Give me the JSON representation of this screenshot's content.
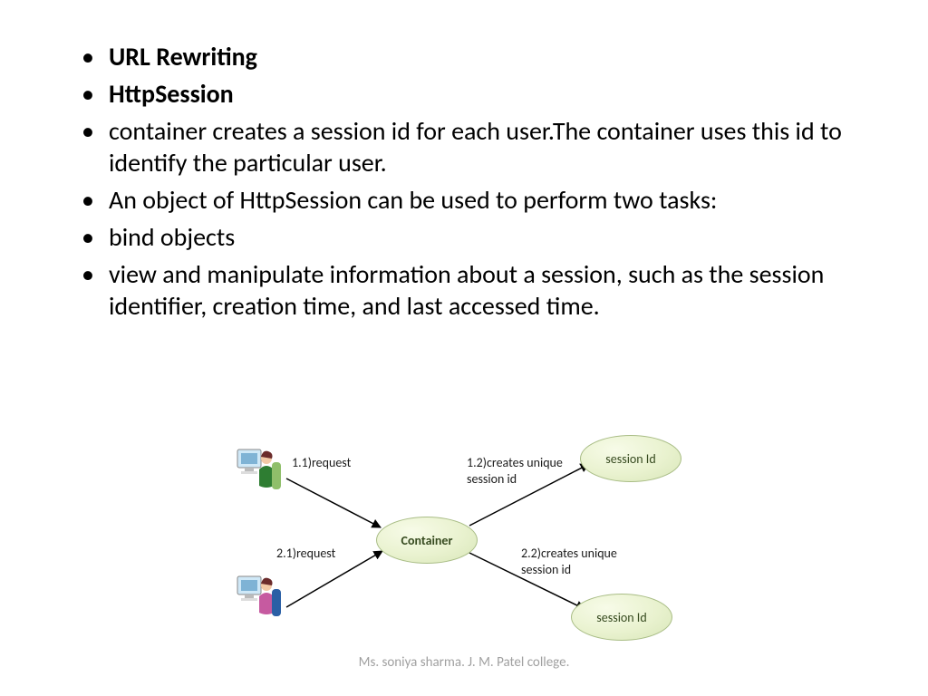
{
  "bullets": {
    "b1": "URL Rewriting",
    "b2": "HttpSession",
    "b3": "container creates a session id for each user.The container uses this id to identify the particular user.",
    "b4": "An object of HttpSession can be used to perform two tasks:",
    "b5": "bind objects",
    "b6": "view and manipulate information about a session, such as the session identifier, creation time, and last accessed time."
  },
  "diagram": {
    "container_label": "Container",
    "session_top_label": "session Id",
    "session_bot_label": "session Id",
    "req1": "1.1)request",
    "req2": "2.1)request",
    "create1_line1": "1.2)creates unique",
    "create1_line2": "session id",
    "create2_line1": "2.2)creates unique",
    "create2_line2": "session id"
  },
  "footer": "Ms. soniya sharma. J. M. Patel college."
}
